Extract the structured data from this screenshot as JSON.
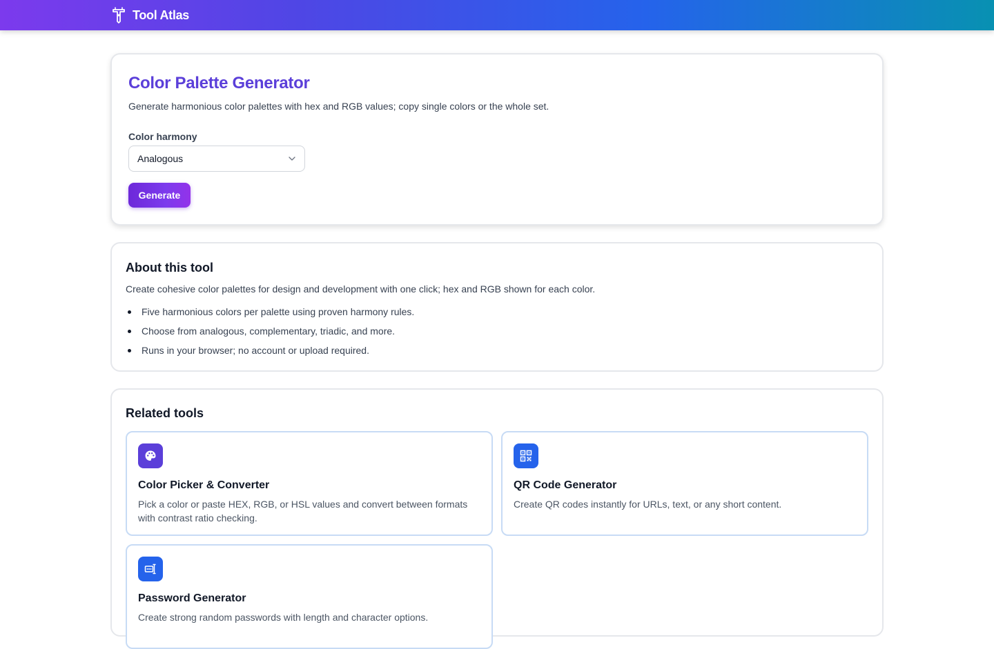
{
  "header": {
    "brand_name": "Tool Atlas",
    "brand_icon": "tool-logo-icon",
    "gradient": [
      "#7c3aed",
      "#4f46e5",
      "#2563eb",
      "#0891b2"
    ]
  },
  "tool": {
    "title": "Color Palette Generator",
    "description": "Generate harmonious color palettes with hex and RGB values; copy single colors or the whole set.",
    "harmony_label": "Color harmony",
    "harmony_value": "Analogous",
    "generate_label": "Generate",
    "accent": "#5b3fd9"
  },
  "about": {
    "title": "About this tool",
    "text": "Create cohesive color palettes for design and development with one click; hex and RGB shown for each color.",
    "bullets": [
      "Five harmonious colors per palette using proven harmony rules.",
      "Choose from analogous, complementary, triadic, and more.",
      "Runs in your browser; no account or upload required."
    ]
  },
  "related": {
    "title": "Related tools",
    "tools": [
      {
        "name": "Color Picker & Converter",
        "description": "Pick a color or paste HEX, RGB, or HSL values and convert between formats with contrast ratio checking.",
        "icon": "palette-icon",
        "icon_bg": "#5b3fd9"
      },
      {
        "name": "QR Code Generator",
        "description": "Create QR codes instantly for URLs, text, or any short content.",
        "icon": "qr-code-icon",
        "icon_bg": "#2563eb"
      },
      {
        "name": "Password Generator",
        "description": "Create strong random passwords with length and character options.",
        "icon": "password-icon",
        "icon_bg": "#2563eb"
      }
    ]
  }
}
